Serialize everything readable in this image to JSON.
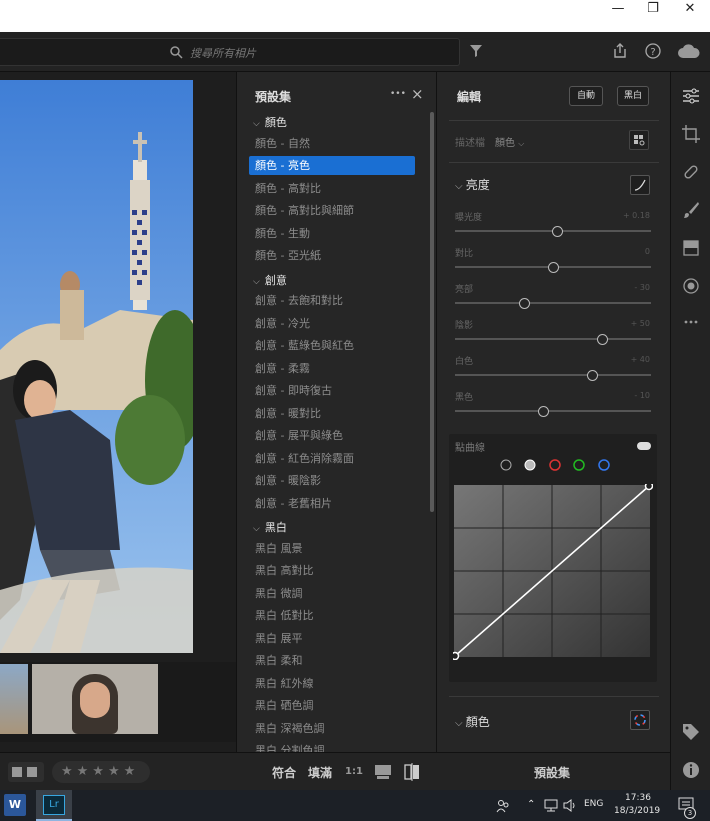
{
  "titlebar": {
    "minimize": "—",
    "maximize": "❐",
    "close": "✕"
  },
  "topbar": {
    "search_placeholder": "搜尋所有相片"
  },
  "presets": {
    "title": "預設集",
    "more": "•••",
    "close": "×",
    "groups": [
      {
        "label": "顏色",
        "items": [
          "顏色 - 自然",
          "顏色 - 亮色",
          "顏色 - 高對比",
          "顏色 - 高對比與細節",
          "顏色 - 生動",
          "顏色 - 亞光紙"
        ]
      },
      {
        "label": "創意",
        "items": [
          "創意 - 去飽和對比",
          "創意 - 冷光",
          "創意 - 藍綠色與紅色",
          "創意 - 柔霧",
          "創意 - 即時復古",
          "創意 - 暖對比",
          "創意 - 展平與綠色",
          "創意 - 紅色消除霧面",
          "創意 - 暖陰影",
          "創意 - 老舊相片"
        ]
      },
      {
        "label": "黑白",
        "items": [
          "黑白 風景",
          "黑白 高對比",
          "黑白 微調",
          "黑白 低對比",
          "黑白 展平",
          "黑白 柔和",
          "黑白 紅外線",
          "黑白 硒色調",
          "黑白 深褐色調",
          "黑白 分割色調"
        ]
      }
    ],
    "selected": "顏色 - 亮色"
  },
  "edit": {
    "title": "編輯",
    "auto_label": "自動",
    "bw_label": "黑白",
    "profile_label": "描述檔",
    "profile_value": "顏色",
    "light_section": "亮度",
    "sliders": [
      {
        "label": "曝光度",
        "value": "+ 0.18",
        "pos": 0.52
      },
      {
        "label": "對比",
        "value": "0",
        "pos": 0.5
      },
      {
        "label": "亮部",
        "value": "- 30",
        "pos": 0.35
      },
      {
        "label": "陰影",
        "value": "+ 50",
        "pos": 0.75
      },
      {
        "label": "白色",
        "value": "+ 40",
        "pos": 0.7
      },
      {
        "label": "黑色",
        "value": "- 10",
        "pos": 0.45
      }
    ],
    "curve_label": "點曲線",
    "color_section": "顏色"
  },
  "bottombar": {
    "fit": "符合",
    "fill": "填滿",
    "ratio": "1:1",
    "presets_button": "預設集"
  },
  "taskbar": {
    "lang": "ENG",
    "time": "17:36",
    "date": "18/3/2019",
    "notif_count": "3",
    "word_label": "W",
    "lr_label": "Lr"
  },
  "colors": {
    "accent": "#1a6fd3",
    "panel": "#262626",
    "background": "#1a1a1a"
  }
}
